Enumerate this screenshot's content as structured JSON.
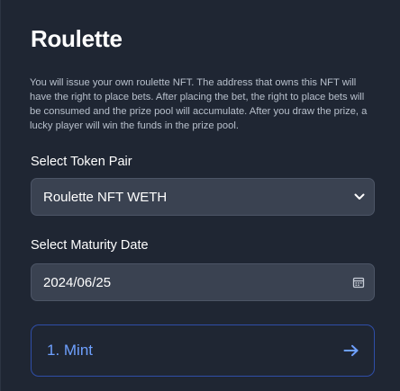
{
  "header": {
    "title": "Roulette"
  },
  "description": "You will issue your own roulette NFT. The address that owns this NFT will have the right to place bets. After placing the bet, the right to place bets will be consumed and the prize pool will accumulate. After you draw the prize, a lucky player will win the funds in the prize pool.",
  "token_pair": {
    "label": "Select Token Pair",
    "selected": "Roulette NFT WETH"
  },
  "maturity": {
    "label": "Select Maturity Date",
    "value": "2024/06/25"
  },
  "mint_button": {
    "label": "1. Mint"
  },
  "colors": {
    "background": "#1f2633",
    "field": "#3a4251",
    "accent": "#6ea0ff",
    "accent_border": "#2f4ea8"
  },
  "icons": {
    "select_chevron": "chevron-down-icon",
    "calendar": "calendar-icon",
    "arrow": "arrow-right-icon"
  }
}
